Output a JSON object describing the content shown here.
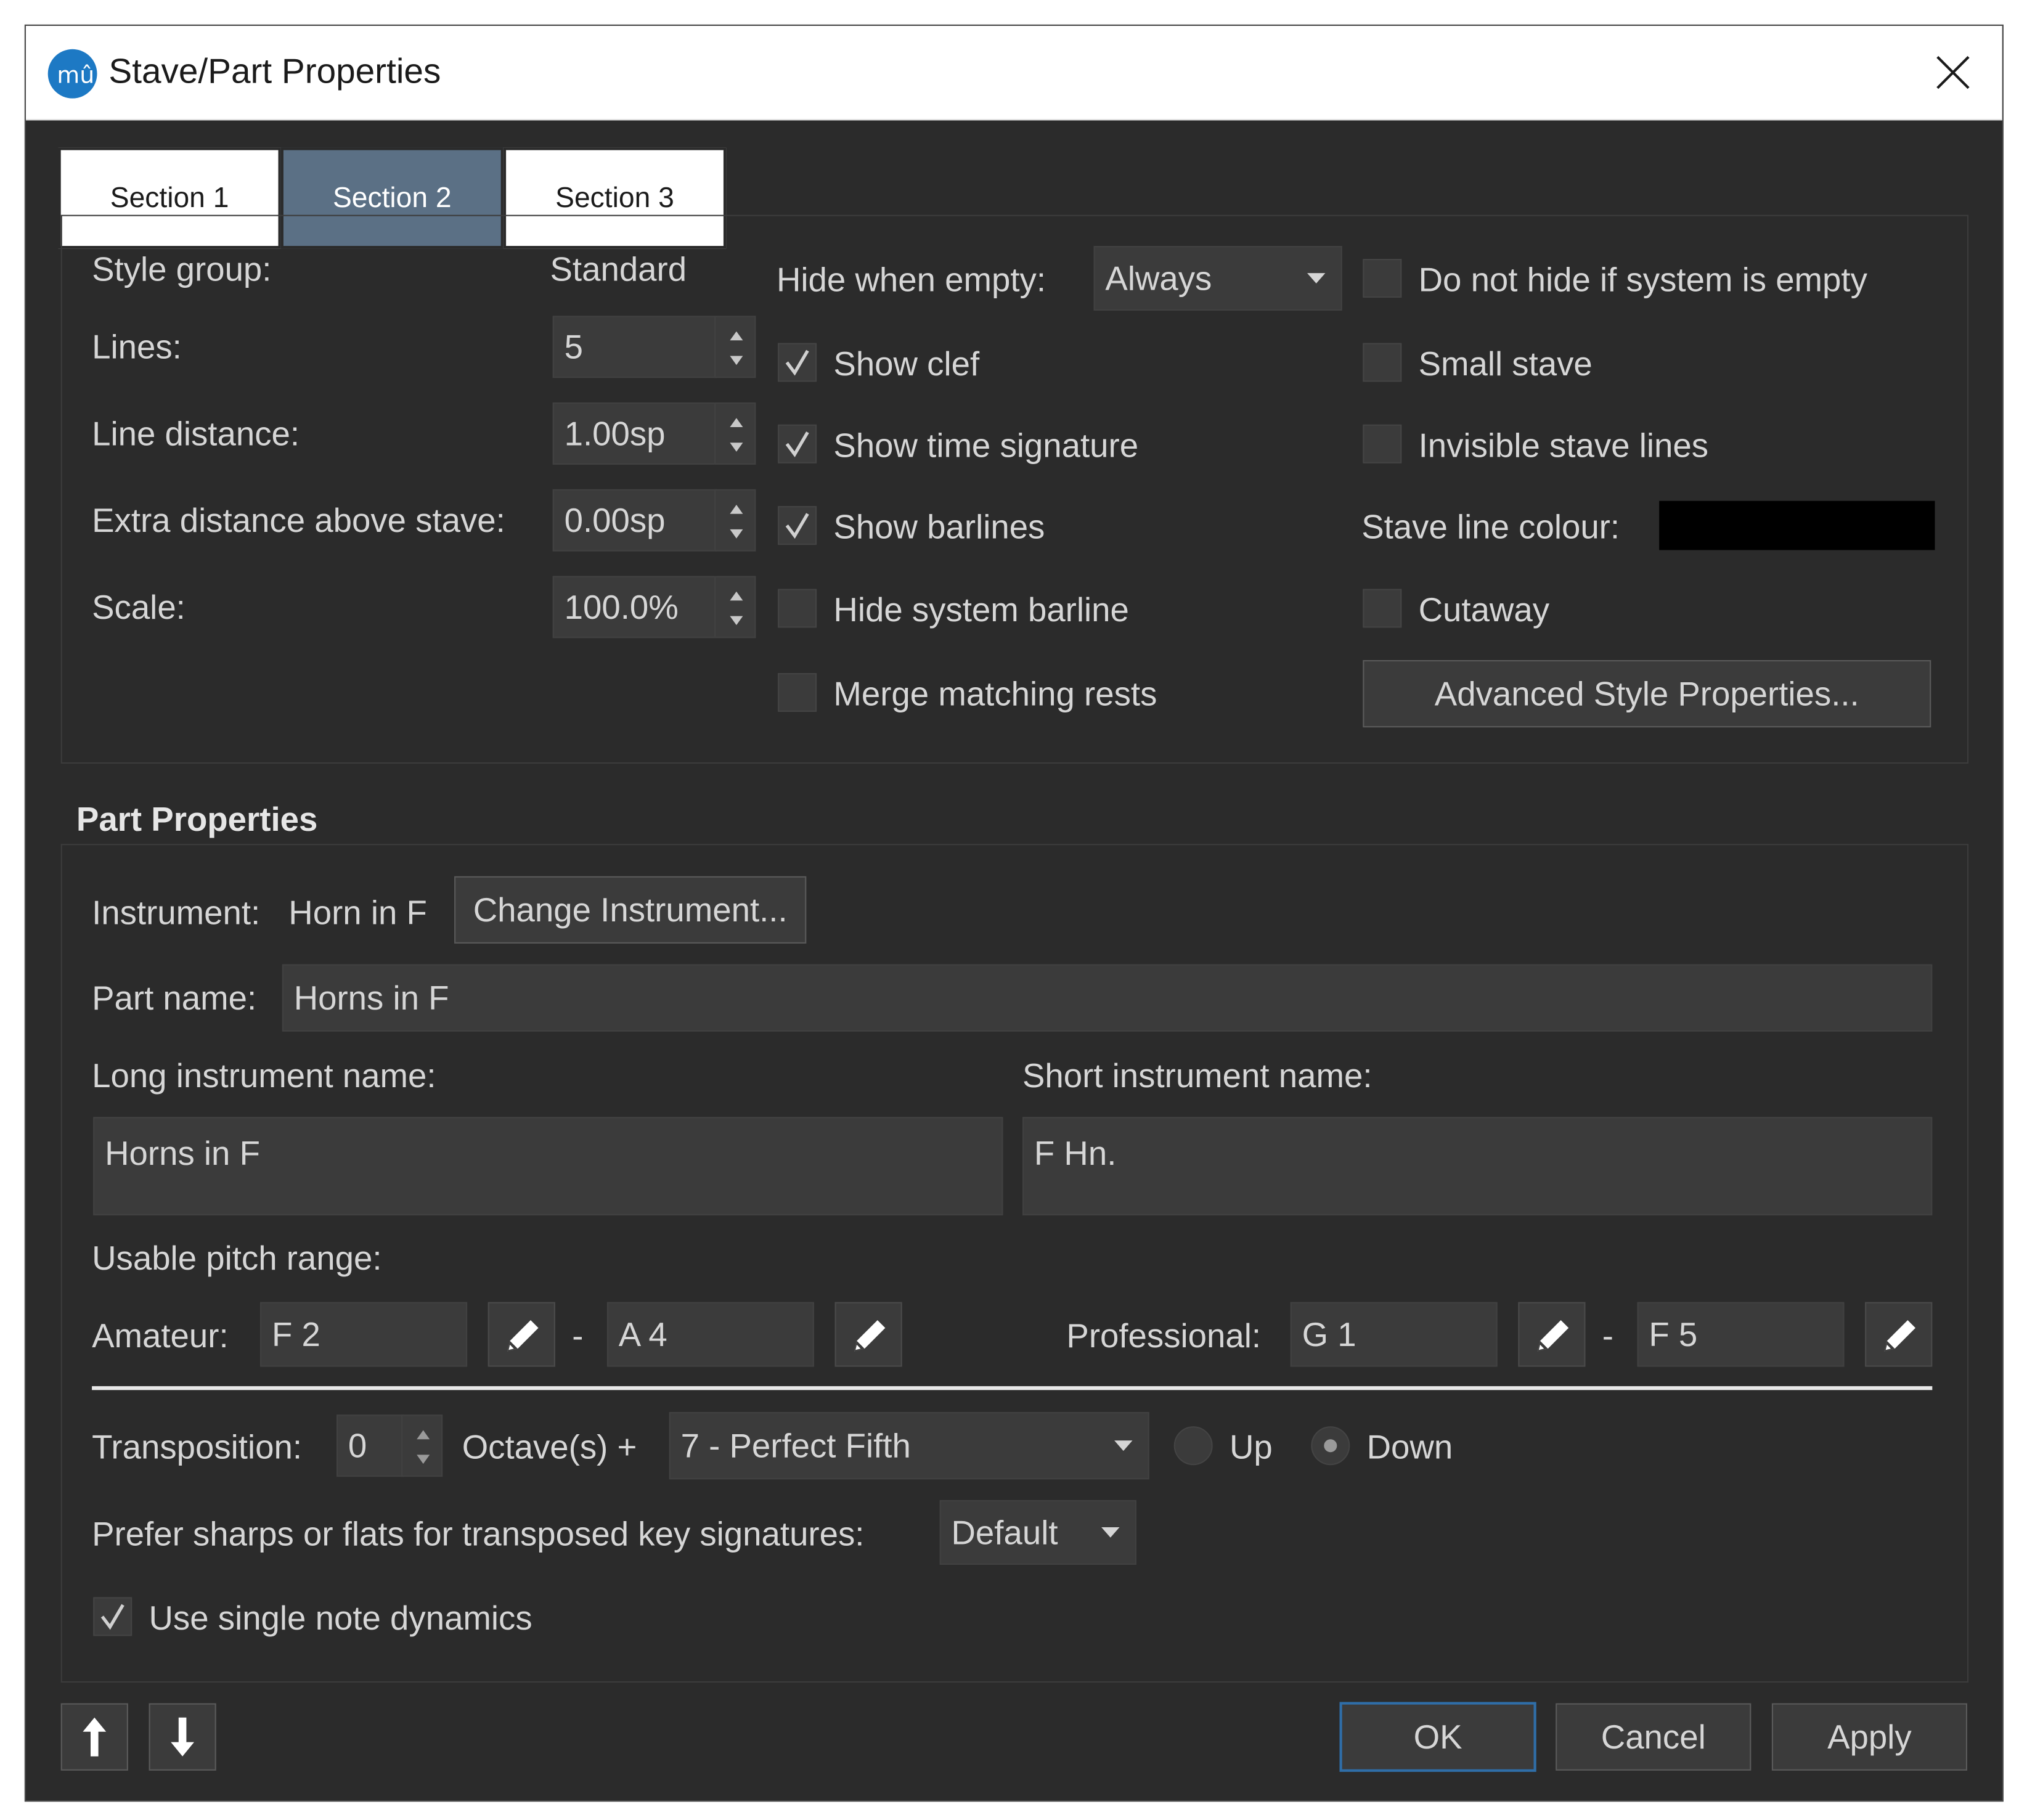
{
  "window": {
    "title": "Stave/Part Properties"
  },
  "tabs": [
    "Section 1",
    "Section 2",
    "Section 3"
  ],
  "stave": {
    "style_group_label": "Style group:",
    "style_group_value": "Standard",
    "lines_label": "Lines:",
    "lines_value": "5",
    "line_distance_label": "Line distance:",
    "line_distance_value": "1.00sp",
    "extra_distance_label": "Extra distance above stave:",
    "extra_distance_value": "0.00sp",
    "scale_label": "Scale:",
    "scale_value": "100.0%",
    "hide_when_empty_label": "Hide when empty:",
    "hide_when_empty_value": "Always",
    "show_clef": "Show clef",
    "show_clef_checked": true,
    "show_time_signature": "Show time signature",
    "show_time_signature_checked": true,
    "show_barlines": "Show barlines",
    "show_barlines_checked": true,
    "hide_system_barline": "Hide system barline",
    "hide_system_barline_checked": false,
    "merge_matching_rests": "Merge matching rests",
    "merge_matching_rests_checked": false,
    "do_not_hide": "Do not hide if system is empty",
    "do_not_hide_checked": false,
    "small_stave": "Small stave",
    "small_stave_checked": false,
    "invisible_stave_lines": "Invisible stave lines",
    "invisible_stave_lines_checked": false,
    "stave_line_colour_label": "Stave line colour:",
    "stave_line_colour": "#000000",
    "cutaway": "Cutaway",
    "cutaway_checked": false,
    "advanced_button": "Advanced Style Properties..."
  },
  "part": {
    "section_title": "Part Properties",
    "instrument_label": "Instrument:",
    "instrument_value": "Horn in F",
    "change_instrument_button": "Change Instrument...",
    "part_name_label": "Part name:",
    "part_name_value": "Horns in F",
    "long_name_label": "Long instrument name:",
    "long_name_value": "Horns in F",
    "short_name_label": "Short instrument name:",
    "short_name_value": "F Hn.",
    "usable_range_label": "Usable pitch range:",
    "amateur_label": "Amateur:",
    "amateur_low": "F 2",
    "amateur_high": "A 4",
    "professional_label": "Professional:",
    "professional_low": "G 1",
    "professional_high": "F 5",
    "range_separator": "-",
    "transposition_label": "Transposition:",
    "transposition_octaves": "0",
    "octaves_label": "Octave(s) +",
    "interval_value": "7 - Perfect Fifth",
    "up_label": "Up",
    "down_label": "Down",
    "direction_selected": "Down",
    "prefer_label": "Prefer sharps or flats for transposed key signatures:",
    "prefer_value": "Default",
    "single_note_dynamics": "Use single note dynamics",
    "single_note_dynamics_checked": true
  },
  "footer": {
    "up_arrow_icon": "arrow-up-icon",
    "down_arrow_icon": "arrow-down-icon",
    "ok": "OK",
    "cancel": "Cancel",
    "apply": "Apply"
  },
  "colors": {
    "background": "#2b2b2b",
    "field": "#3b3b3b",
    "text": "#d6d6d6",
    "active_tab": "#5b7085",
    "ok_border": "#2f6ea8"
  }
}
